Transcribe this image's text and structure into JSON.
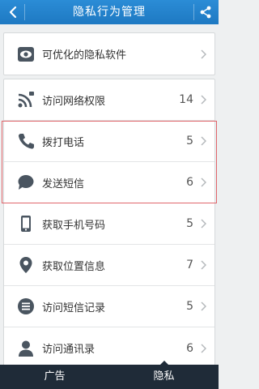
{
  "header": {
    "title": "隐私行为管理"
  },
  "top_card": {
    "items": [
      {
        "label": "可优化的隐私软件"
      }
    ]
  },
  "list": {
    "items": [
      {
        "label": "访问网络权限",
        "count": "14"
      },
      {
        "label": "拨打电话",
        "count": "5"
      },
      {
        "label": "发送短信",
        "count": "6"
      },
      {
        "label": "获取手机号码",
        "count": "5"
      },
      {
        "label": "获取位置信息",
        "count": "7"
      },
      {
        "label": "访问短信记录",
        "count": "5"
      },
      {
        "label": "访问通讯录",
        "count": "6"
      }
    ]
  },
  "bottom_tabs": [
    {
      "label": "广告"
    },
    {
      "label": "隐私"
    }
  ],
  "colors": {
    "header": "#2b8cd6",
    "icon": "#4a5560",
    "highlight": "#e0666b",
    "bottom_bar": "#1f2b38"
  }
}
